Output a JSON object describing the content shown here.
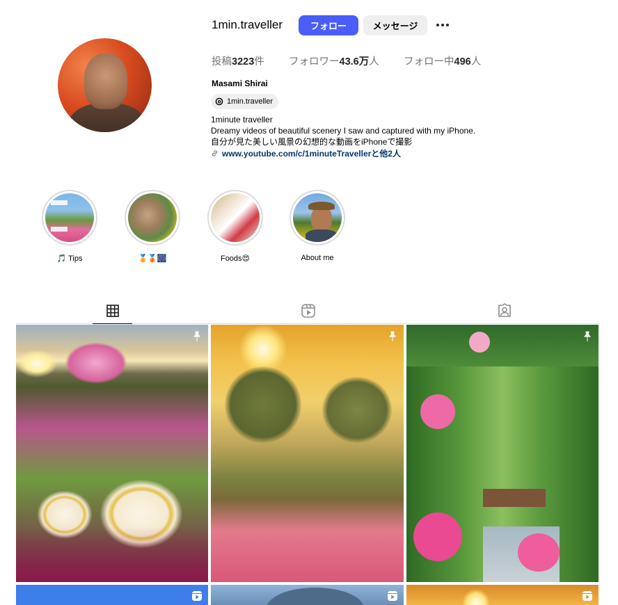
{
  "profile": {
    "username": "1min.traveller",
    "follow_label": "フォロー",
    "message_label": "メッセージ",
    "more_icon": "more-horizontal-icon",
    "stats": [
      {
        "label": "投稿",
        "value": "3223",
        "suffix": "件"
      },
      {
        "label": "フォロワー",
        "value": "43.6万",
        "suffix": "人"
      },
      {
        "label": "フォロー中",
        "value": "496",
        "suffix": "人"
      }
    ],
    "full_name": "Masami Shirai",
    "threads_handle": "1min.traveller",
    "bio_lines": [
      "1minute traveller",
      "Dreamy videos of beautiful scenery I saw and captured with my iPhone.",
      "自分が見た美しい風景の幻想的な動画をiPhoneで撮影"
    ],
    "link_text": "www.youtube.com/c/1minuteTravellerと他2人"
  },
  "highlights": [
    {
      "label": "🎵 Tips"
    },
    {
      "label": "🏅🥉🎆"
    },
    {
      "label": "Foods😍"
    },
    {
      "label": "About me"
    }
  ],
  "tabs": [
    {
      "name": "posts",
      "icon": "grid-icon",
      "active": true
    },
    {
      "name": "reels",
      "icon": "reels-icon",
      "active": false
    },
    {
      "name": "tagged",
      "icon": "tagged-icon",
      "active": false
    }
  ],
  "grid": [
    {
      "subject": "cosmos flowers at sunset",
      "badge": "pin-icon"
    },
    {
      "subject": "foggy sunrise over flower field",
      "badge": "pin-icon"
    },
    {
      "subject": "rose garden with bench",
      "badge": "pin-icon"
    },
    {
      "subject": "blue sky",
      "badge": "reel-icon"
    },
    {
      "subject": "mountain",
      "badge": "reel-icon"
    },
    {
      "subject": "sunset",
      "badge": "reel-icon"
    }
  ]
}
